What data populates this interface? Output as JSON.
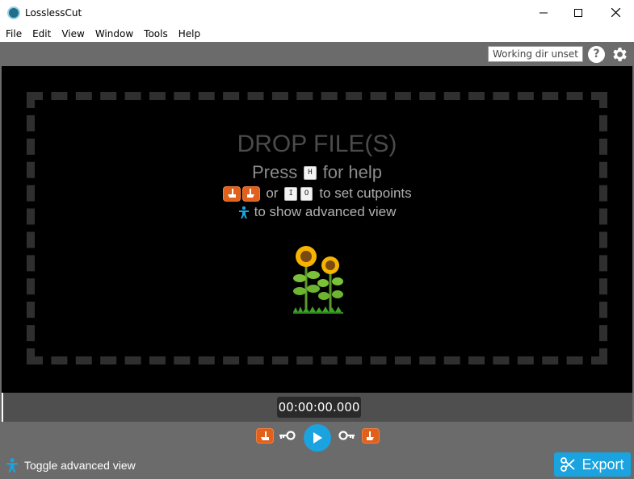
{
  "window": {
    "title": "LosslessCut"
  },
  "menu": [
    "File",
    "Edit",
    "View",
    "Window",
    "Tools",
    "Help"
  ],
  "toolbar": {
    "working_dir": "Working dir unset",
    "help_label": "?"
  },
  "drop": {
    "title": "DROP FILE(S)",
    "help_prefix": "Press",
    "help_key": "H",
    "help_suffix": "for help",
    "cut_or": "or",
    "cut_key_in": "I",
    "cut_key_out": "O",
    "cut_suffix": "to set cutpoints",
    "adv_suffix": "to show advanced view"
  },
  "timeline": {
    "timecode": "00:00:00.000"
  },
  "footer": {
    "toggle_advanced": "Toggle advanced view",
    "export_label": "Export"
  },
  "colors": {
    "accent": "#1aa3df",
    "cut_orange": "#e0601c",
    "panel_gray": "#6b6b6b"
  }
}
